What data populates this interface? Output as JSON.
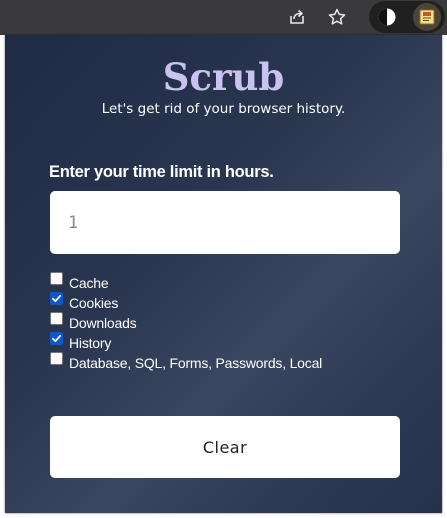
{
  "toolbar": {
    "share_icon": "share-icon",
    "star_icon": "bookmark-star-icon",
    "dark_mode_extension_icon": "dark-mode-icon",
    "scrub_extension_icon": "scrub-extension-icon"
  },
  "popup": {
    "title": "Scrub",
    "subtitle": "Let's get rid of your browser history.",
    "time_label": "Enter your time limit in hours.",
    "time_input": {
      "value": "",
      "placeholder": "1"
    },
    "options": [
      {
        "label": "Cache",
        "checked": false
      },
      {
        "label": "Cookies",
        "checked": true
      },
      {
        "label": "Downloads",
        "checked": false
      },
      {
        "label": "History",
        "checked": true
      },
      {
        "label": "Database, SQL, Forms, Passwords, Local",
        "checked": false
      }
    ],
    "clear_label": "Clear"
  },
  "colors": {
    "title": "#c9c3f0",
    "checkbox_checked": "#0b57d0",
    "popup_background": "#2a3650"
  }
}
